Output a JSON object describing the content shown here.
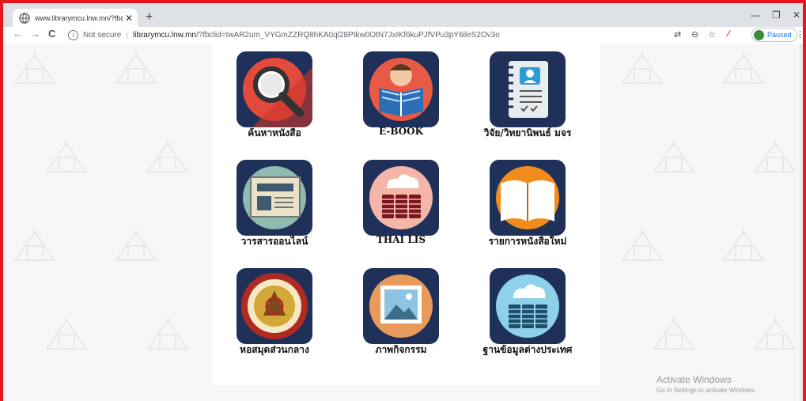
{
  "browser": {
    "tab_title": "www.librarymcu.lnw.mn/?fbclid=",
    "tab_close": "✕",
    "new_tab": "+",
    "minimize": "—",
    "restore": "❐",
    "close": "✕",
    "not_secure": "Not secure",
    "url_host": "librarymcu.lnw.mn",
    "url_rest": "/?fbclid=IwAR2um_VYGmZZRQ8hKA0ql28Ptkw0OtN7JxIKf6kuPJfVPu3pY6ileS2Ov3o",
    "profile_status": "Paused",
    "back": "←",
    "forward": "→",
    "reload": "C",
    "menu": "⋮"
  },
  "menu_items": [
    {
      "label": "ค้นหาหนังสือ",
      "icon": "magnifier-icon",
      "bg": "#e34a3c"
    },
    {
      "label": "E-BOOK",
      "icon": "reading-person-icon",
      "bg": "#e85a46"
    },
    {
      "label": "วิจัย/วิทยานิพนธ์ มจร",
      "icon": "notebook-user-icon",
      "bg": "#1f3158"
    },
    {
      "label": "วารสารออนไลน์",
      "icon": "newspaper-icon",
      "bg": "#8fbab0"
    },
    {
      "label": "THAI LIS",
      "icon": "cloud-server-icon",
      "bg": "#f3b6a8"
    },
    {
      "label": "รายการหนังสือใหม่",
      "icon": "open-book-icon",
      "bg": "#f08c1c"
    },
    {
      "label": "หอสมุดส่วนกลาง",
      "icon": "university-seal-icon",
      "bg": "#f2e3c0"
    },
    {
      "label": "ภาพกิจกรรม",
      "icon": "picture-icon",
      "bg": "#e79a5a"
    },
    {
      "label": "ฐานข้อมูลต่างประเทศ",
      "icon": "cloud-database-icon",
      "bg": "#8fd0ea"
    }
  ],
  "windows_watermark": {
    "title": "Activate Windows",
    "subtitle": "Go to Settings to activate Windows."
  }
}
